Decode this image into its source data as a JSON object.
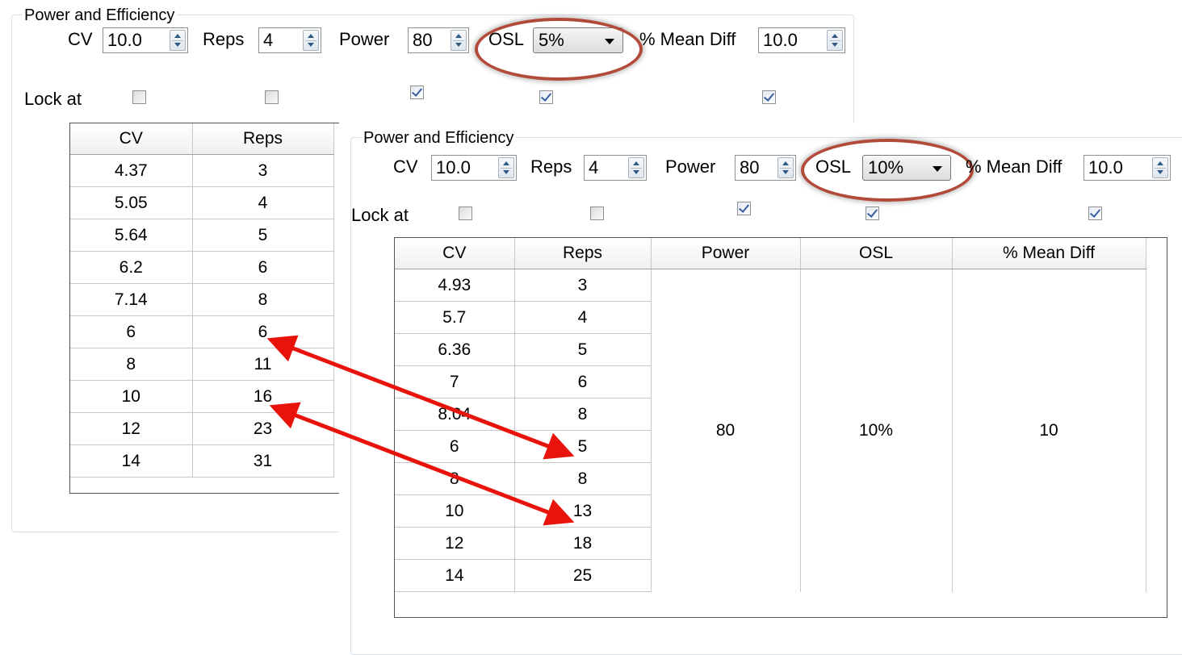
{
  "back": {
    "title": "Power and Efficiency",
    "cv_label": "CV",
    "cv_value": "10.0",
    "reps_label": "Reps",
    "reps_value": "4",
    "power_label": "Power",
    "power_value": "80",
    "osl_label": "OSL",
    "osl_value": "5%",
    "mean_diff_label": "% Mean Diff",
    "mean_diff_value": "10.0",
    "lock_label": "Lock at",
    "locks": [
      false,
      false,
      true,
      true,
      true
    ],
    "columns": [
      "CV",
      "Reps"
    ],
    "rows": [
      [
        "4.37",
        "3"
      ],
      [
        "5.05",
        "4"
      ],
      [
        "5.64",
        "5"
      ],
      [
        "6.2",
        "6"
      ],
      [
        "7.14",
        "8"
      ],
      [
        "6",
        "6"
      ],
      [
        "8",
        "11"
      ],
      [
        "10",
        "16"
      ],
      [
        "12",
        "23"
      ],
      [
        "14",
        "31"
      ]
    ]
  },
  "front": {
    "title": "Power and Efficiency",
    "cv_label": "CV",
    "cv_value": "10.0",
    "reps_label": "Reps",
    "reps_value": "4",
    "power_label": "Power",
    "power_value": "80",
    "osl_label": "OSL",
    "osl_value": "10%",
    "mean_diff_label": "% Mean Diff",
    "mean_diff_value": "10.0",
    "lock_label": "Lock at",
    "locks": [
      false,
      false,
      true,
      true,
      true
    ],
    "columns": [
      "CV",
      "Reps",
      "Power",
      "OSL",
      "% Mean Diff"
    ],
    "rows": [
      [
        "4.93",
        "3"
      ],
      [
        "5.7",
        "4"
      ],
      [
        "6.36",
        "5"
      ],
      [
        "7",
        "6"
      ],
      [
        "8.04",
        "8"
      ],
      [
        "6",
        "5"
      ],
      [
        "8",
        "8"
      ],
      [
        "10",
        "13"
      ],
      [
        "12",
        "18"
      ],
      [
        "14",
        "25"
      ]
    ],
    "merged": {
      "power": "80",
      "osl": "10%",
      "mean_diff": "10"
    }
  },
  "colors": {
    "highlight_oval": "#b24a3a",
    "arrow": "#e8140c"
  }
}
